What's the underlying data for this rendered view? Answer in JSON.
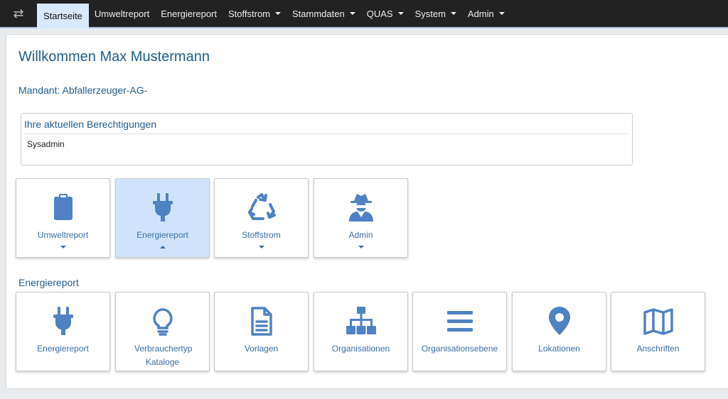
{
  "navbar": {
    "toggle_icon": "swap-arrows-icon",
    "items": [
      {
        "label": "Startseite",
        "active": true,
        "dropdown": false
      },
      {
        "label": "Umweltreport",
        "active": false,
        "dropdown": false
      },
      {
        "label": "Energiereport",
        "active": false,
        "dropdown": false
      },
      {
        "label": "Stoffstrom",
        "active": false,
        "dropdown": true
      },
      {
        "label": "Stammdaten",
        "active": false,
        "dropdown": true
      },
      {
        "label": "QUAS",
        "active": false,
        "dropdown": true
      },
      {
        "label": "System",
        "active": false,
        "dropdown": true
      },
      {
        "label": "Admin",
        "active": false,
        "dropdown": true
      }
    ]
  },
  "main": {
    "welcome": "Willkommen Max Mustermann",
    "mandant": "Mandant: Abfallerzeuger-AG-",
    "permissions": {
      "title": "Ihre aktuellen Berechtigungen",
      "value": "Sysadmin"
    },
    "modules": [
      {
        "label": "Umweltreport",
        "icon": "clipboard-icon",
        "expanded": false
      },
      {
        "label": "Energiereport",
        "icon": "plug-icon",
        "expanded": true
      },
      {
        "label": "Stoffstrom",
        "icon": "recycle-icon",
        "expanded": false
      },
      {
        "label": "Admin",
        "icon": "user-secret-icon",
        "expanded": false
      }
    ],
    "section_title": "Energiereport",
    "sub_tiles": [
      {
        "label": "Energiereport",
        "icon": "plug-icon"
      },
      {
        "label": "Verbrauchertyp Kataloge",
        "icon": "lightbulb-icon"
      },
      {
        "label": "Vorlagen",
        "icon": "document-icon"
      },
      {
        "label": "Organisationen",
        "icon": "sitemap-icon"
      },
      {
        "label": "Organisationsebene",
        "icon": "bars-icon"
      },
      {
        "label": "Lokationen",
        "icon": "map-marker-icon"
      },
      {
        "label": "Anschriften",
        "icon": "map-icon"
      }
    ]
  },
  "colors": {
    "navbar_bg": "#222222",
    "active_tab_bg": "#d8e9fb",
    "accent_text": "#1f5d8f",
    "icon_blue": "#4f82c4",
    "selected_tile_bg": "#cfe4fb"
  }
}
